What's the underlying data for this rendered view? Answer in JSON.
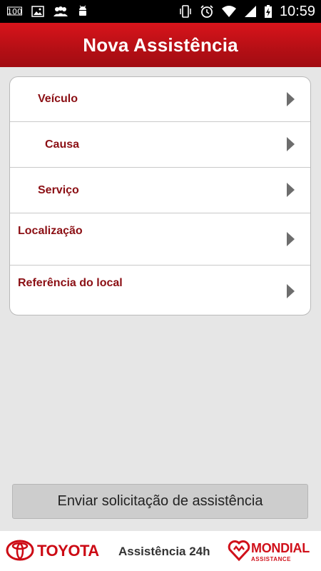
{
  "status_bar": {
    "time": "10:59",
    "left_icons": [
      "battery-100-icon",
      "image-icon",
      "people-icon",
      "android-icon"
    ],
    "right_icons": [
      "vibrate-icon",
      "alarm-icon",
      "wifi-icon",
      "signal-icon",
      "battery-charging-icon"
    ]
  },
  "header": {
    "title": "Nova Assistência",
    "color": "#c3121a"
  },
  "menu": {
    "items": [
      {
        "label": "Veículo"
      },
      {
        "label": "Causa"
      },
      {
        "label": "Serviço"
      },
      {
        "label": "Localização"
      },
      {
        "label": "Referência do local"
      }
    ],
    "label_color": "#8b0f14"
  },
  "action": {
    "label": "Enviar solicitação de assistência"
  },
  "footer": {
    "brand_left": "TOYOTA",
    "center_text": "Assistência 24h",
    "brand_right": "MONDIAL",
    "brand_right_sub": "ASSISTANCE"
  }
}
